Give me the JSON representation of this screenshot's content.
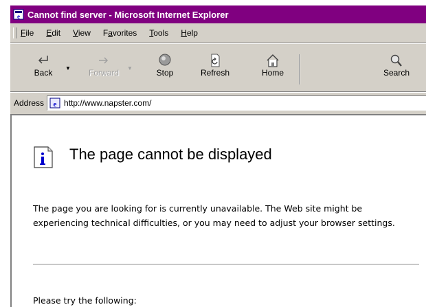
{
  "window": {
    "title": "Cannot find server - Microsoft Internet Explorer",
    "title_bar_color": "#800080"
  },
  "menu": {
    "items": [
      {
        "pre": "",
        "u": "F",
        "post": "ile"
      },
      {
        "pre": "",
        "u": "E",
        "post": "dit"
      },
      {
        "pre": "",
        "u": "V",
        "post": "iew"
      },
      {
        "pre": "F",
        "u": "a",
        "post": "vorites"
      },
      {
        "pre": "",
        "u": "T",
        "post": "ools"
      },
      {
        "pre": "",
        "u": "H",
        "post": "elp"
      }
    ]
  },
  "toolbar": {
    "back": "Back",
    "forward": "Forward",
    "stop": "Stop",
    "refresh": "Refresh",
    "home": "Home",
    "search": "Search",
    "icons": [
      "back-arrow-icon",
      "forward-arrow-icon",
      "stop-icon",
      "refresh-icon",
      "home-icon",
      "search-icon"
    ]
  },
  "address": {
    "label": "Address",
    "url": "http://www.napster.com/"
  },
  "content": {
    "title": "The page cannot be displayed",
    "body": "The page you are looking for is currently unavailable. The Web site might be experiencing technical difficulties, or you may need to adjust your browser settings.",
    "try": "Please try the following:"
  }
}
